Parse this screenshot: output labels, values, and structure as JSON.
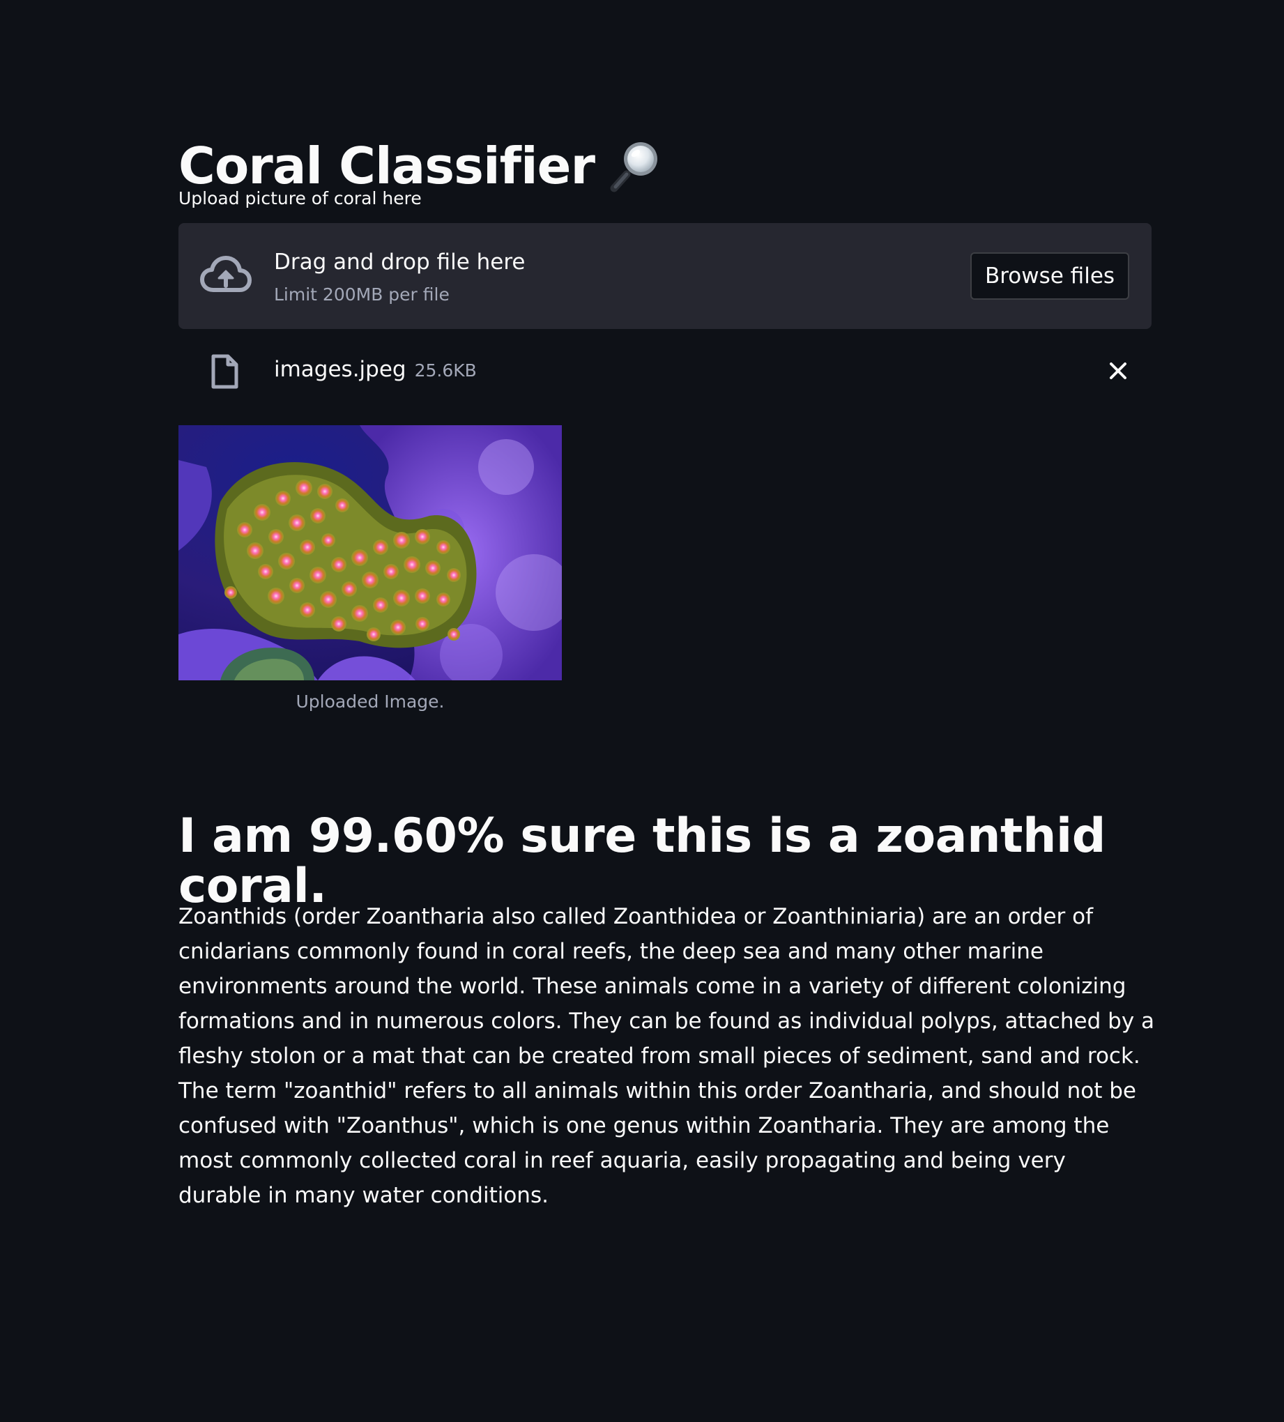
{
  "app": {
    "title": "Coral Classifier",
    "title_icon": "magnifying-glass-icon"
  },
  "uploader": {
    "label": "Upload picture of coral here",
    "drag_drop_text": "Drag and drop file here",
    "limit_text": "Limit 200MB per file",
    "browse_button_label": "Browse files",
    "upload_icon": "cloud-upload-icon"
  },
  "uploaded_file": {
    "name": "images.jpeg",
    "size": "25.6KB",
    "file_icon": "file-icon",
    "delete_icon": "close-icon"
  },
  "image": {
    "caption": "Uploaded Image."
  },
  "result": {
    "heading": "I am 99.60% sure this is a zoanthid coral.",
    "description": "Zoanthids (order Zoantharia also called Zoanthidea or Zoanthiniaria) are an order of cnidarians commonly found in coral reefs, the deep sea and many other marine environments around the world. These animals come in a variety of different colonizing formations and in numerous colors. They can be found as individual polyps, attached by a fleshy stolon or a mat that can be created from small pieces of sediment, sand and rock. The term \"zoanthid\" refers to all animals within this order Zoantharia, and should not be confused with \"Zoanthus\", which is one genus within Zoantharia. They are among the most commonly collected coral in reef aquaria, easily propagating and being very durable in many water conditions."
  },
  "colors": {
    "background": "#0e1117",
    "dropzone": "#262730",
    "text": "#fafafa",
    "muted_text": "#a3a8b8"
  }
}
